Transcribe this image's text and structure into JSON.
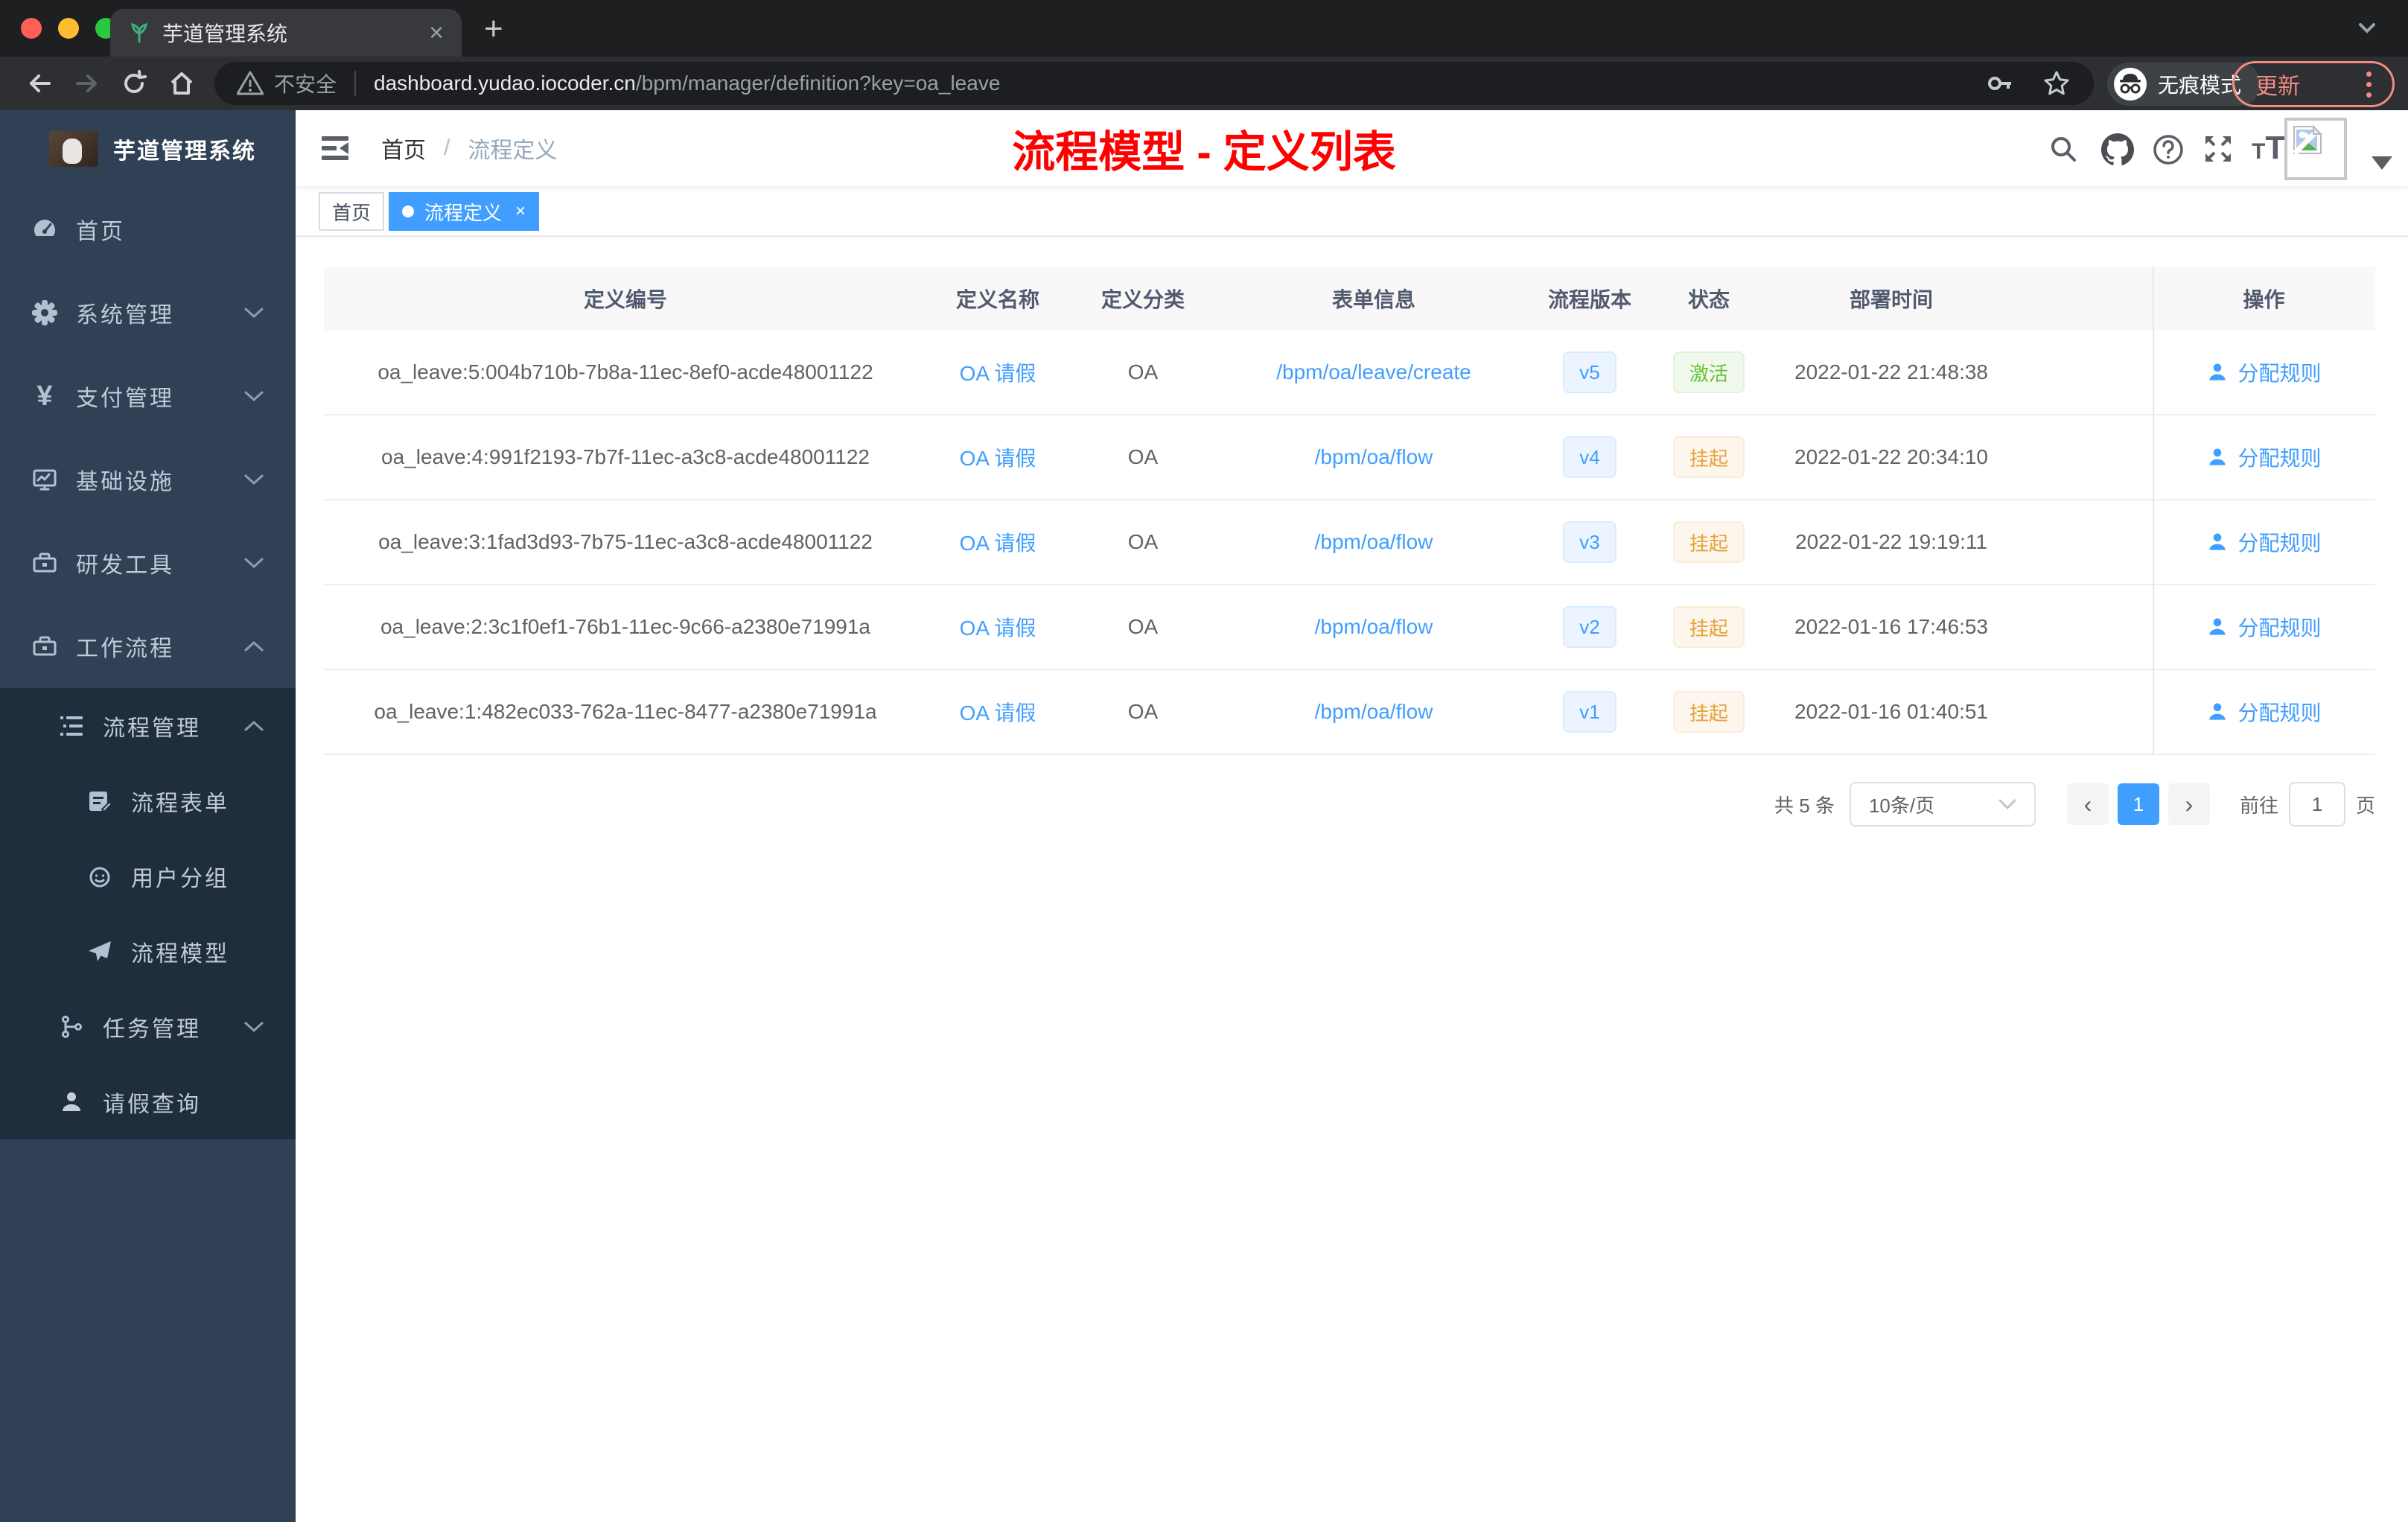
{
  "browser": {
    "tab": {
      "title": "芋道管理系统",
      "close_label": "×",
      "new_tab_label": "+"
    },
    "address": {
      "security_label": "不安全",
      "host": "dashboard.yudao.iocoder.cn",
      "path": "/bpm/manager/definition?key=oa_leave"
    },
    "incognito_label": "无痕模式",
    "update_label": "更新"
  },
  "sidebar": {
    "logo_title": "芋道管理系统",
    "items": [
      {
        "label": "首页",
        "icon": "dashboard-icon",
        "level": 1
      },
      {
        "label": "系统管理",
        "icon": "gear-icon",
        "level": 1,
        "chevron": "down"
      },
      {
        "label": "支付管理",
        "icon": "yen-icon",
        "level": 1,
        "chevron": "down"
      },
      {
        "label": "基础设施",
        "icon": "monitor-icon",
        "level": 1,
        "chevron": "down"
      },
      {
        "label": "研发工具",
        "icon": "toolbox-icon",
        "level": 1,
        "chevron": "down"
      },
      {
        "label": "工作流程",
        "icon": "toolbox-icon",
        "level": 1,
        "chevron": "up"
      },
      {
        "label": "流程管理",
        "icon": "list-icon",
        "level": 2,
        "chevron": "up"
      },
      {
        "label": "流程表单",
        "icon": "form-icon",
        "level": 3
      },
      {
        "label": "用户分组",
        "icon": "face-icon",
        "level": 3
      },
      {
        "label": "流程模型",
        "icon": "paper-plane-icon",
        "level": 3
      },
      {
        "label": "任务管理",
        "icon": "branch-icon",
        "level": 2,
        "chevron": "down"
      },
      {
        "label": "请假查询",
        "icon": "person-icon",
        "level": 2
      }
    ]
  },
  "navbar": {
    "breadcrumb": {
      "home": "首页",
      "separator": "/",
      "current": "流程定义"
    },
    "annotation_title": "流程模型 - 定义列表"
  },
  "tags_view": {
    "tabs": [
      {
        "label": "首页",
        "active": false
      },
      {
        "label": "流程定义",
        "active": true,
        "close_label": "×"
      }
    ]
  },
  "table": {
    "columns": [
      "定义编号",
      "定义名称",
      "定义分类",
      "表单信息",
      "流程版本",
      "状态",
      "部署时间",
      "操作"
    ],
    "rows": [
      {
        "id": "oa_leave:5:004b710b-7b8a-11ec-8ef0-acde48001122",
        "name": "OA 请假",
        "category": "OA",
        "form": "/bpm/oa/leave/create",
        "version": "v5",
        "status": "激活",
        "status_type": "success",
        "deploy_time": "2022-01-22 21:48:38",
        "action": "分配规则"
      },
      {
        "id": "oa_leave:4:991f2193-7b7f-11ec-a3c8-acde48001122",
        "name": "OA 请假",
        "category": "OA",
        "form": "/bpm/oa/flow",
        "version": "v4",
        "status": "挂起",
        "status_type": "warning",
        "deploy_time": "2022-01-22 20:34:10",
        "action": "分配规则"
      },
      {
        "id": "oa_leave:3:1fad3d93-7b75-11ec-a3c8-acde48001122",
        "name": "OA 请假",
        "category": "OA",
        "form": "/bpm/oa/flow",
        "version": "v3",
        "status": "挂起",
        "status_type": "warning",
        "deploy_time": "2022-01-22 19:19:11",
        "action": "分配规则"
      },
      {
        "id": "oa_leave:2:3c1f0ef1-76b1-11ec-9c66-a2380e71991a",
        "name": "OA 请假",
        "category": "OA",
        "form": "/bpm/oa/flow",
        "version": "v2",
        "status": "挂起",
        "status_type": "warning",
        "deploy_time": "2022-01-16 17:46:53",
        "action": "分配规则"
      },
      {
        "id": "oa_leave:1:482ec033-762a-11ec-8477-a2380e71991a",
        "name": "OA 请假",
        "category": "OA",
        "form": "/bpm/oa/flow",
        "version": "v1",
        "status": "挂起",
        "status_type": "warning",
        "deploy_time": "2022-01-16 01:40:51",
        "action": "分配规则"
      }
    ]
  },
  "pagination": {
    "total_label": "共 5 条",
    "page_size_label": "10条/页",
    "current_page": "1",
    "goto_label": "前往",
    "goto_value": "1",
    "page_unit_label": "页"
  },
  "colors": {
    "accent_blue": "#409eff",
    "sidebar_bg": "#304156",
    "submenu_bg": "#1f2d3d",
    "success_text": "#67c23a",
    "warning_text": "#e6a23c",
    "annotation_red": "#ff0000",
    "update_red": "#f28b82"
  }
}
